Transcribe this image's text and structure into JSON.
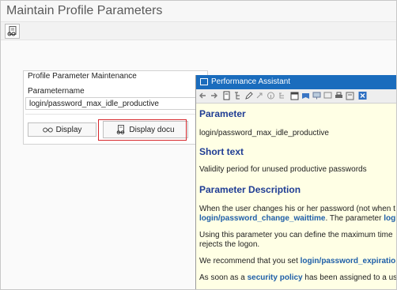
{
  "window": {
    "title": "Maintain Profile Parameters"
  },
  "toolbar": {
    "icon": "glasses-document-icon"
  },
  "maintenance": {
    "title": "Profile Parameter Maintenance",
    "field_label": "Parametername",
    "field_value": "login/password_max_idle_productive",
    "display_label": "Display",
    "display_docu_label": "Display docu"
  },
  "assistant": {
    "title": "Performance Assistant",
    "heading_parameter": "Parameter",
    "parameter_name": "login/password_max_idle_productive",
    "heading_short": "Short text",
    "short_text": "Validity period for unused productive passwords",
    "heading_description": "Parameter Description",
    "desc1_text": "When the user changes his or her password (not when t",
    "desc1_link": "login/password_change_waittime",
    "desc1_after": ". The parameter ",
    "desc1_link2": "logi",
    "desc2_line1": "Using this parameter you can define the maximum time",
    "desc2_line2": "rejects the logon.",
    "desc3_text": "We recommend that you set ",
    "desc3_link": "login/password_expiratio",
    "desc4_text": "As soon as a ",
    "desc4_link": "security policy",
    "desc4_after": " has been assigned to a us"
  },
  "colors": {
    "title_bar": "#1a6cbd",
    "link": "#1f5fa8",
    "heading": "#1f3d94",
    "highlight": "#d6282d",
    "assistant_bg": "#ffffe5"
  }
}
